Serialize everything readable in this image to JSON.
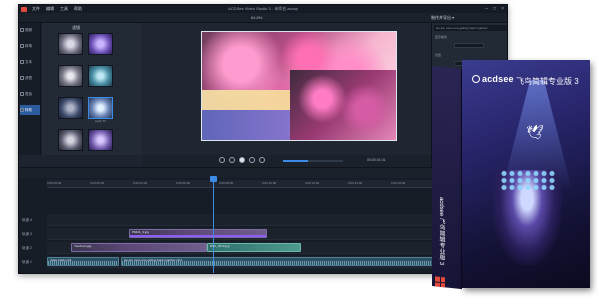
{
  "window": {
    "title": "ACDSee Video Studio 3 - 未命名.acvsp",
    "menu": [
      "文件",
      "编辑",
      "工具",
      "帮助"
    ],
    "menu_short": [
      "视频"
    ],
    "zoom": "64.8%",
    "export_label": "制作并导出 ▾"
  },
  "sidebar": {
    "items": [
      {
        "label": "视频",
        "active": false
      },
      {
        "label": "转场",
        "active": false
      },
      {
        "label": "文本",
        "active": false
      },
      {
        "label": "滤镜",
        "active": false
      },
      {
        "label": "叠加",
        "active": false
      },
      {
        "label": "元素",
        "active": false
      },
      {
        "label": "特效",
        "active": true
      }
    ]
  },
  "media": {
    "header": "滤镜",
    "thumbs": [
      "",
      "",
      "",
      "",
      "",
      "Light TV",
      "",
      ""
    ]
  },
  "transport": {
    "timecode": "00:00:01.01",
    "progress_fraction": 0.42
  },
  "properties": {
    "search_placeholder": "we are more one getting back together...",
    "rows": [
      "显示模式",
      "位置",
      "缩放",
      "旋转",
      "不透明度"
    ]
  },
  "timeline": {
    "ticks": [
      "0:00:00:00",
      "0:00:02:00",
      "0:00:04:00",
      "0:00:06:00",
      "0:00:08:00",
      "0:00:10:00",
      "0:00:12:00",
      "0:00:14:00",
      "0:00:16:00",
      "0:00:18:00"
    ],
    "tracks": [
      {
        "label": "轨道 4",
        "clips": []
      },
      {
        "label": "轨道 3",
        "clips": [
          {
            "name": "P9421_3.jpg",
            "kind": "video"
          }
        ]
      },
      {
        "label": "轨道 2",
        "clips": [
          {
            "name": "YourCam.jpg",
            "kind": "video"
          },
          {
            "name": "DSC_0072.jpg",
            "kind": "teal"
          }
        ]
      },
      {
        "label": "轨道 1",
        "clips": [
          {
            "name": "video-track.mp4",
            "kind": "audio"
          },
          {
            "name": "we are more one getting back together.mp4",
            "kind": "audio"
          }
        ]
      }
    ]
  },
  "box": {
    "brand": "acdsee",
    "product": "飞鸟简辑专业版 3",
    "spine_text": "acdsee 飞鸟简辑专业版 3",
    "accent": "#e24a3b"
  }
}
